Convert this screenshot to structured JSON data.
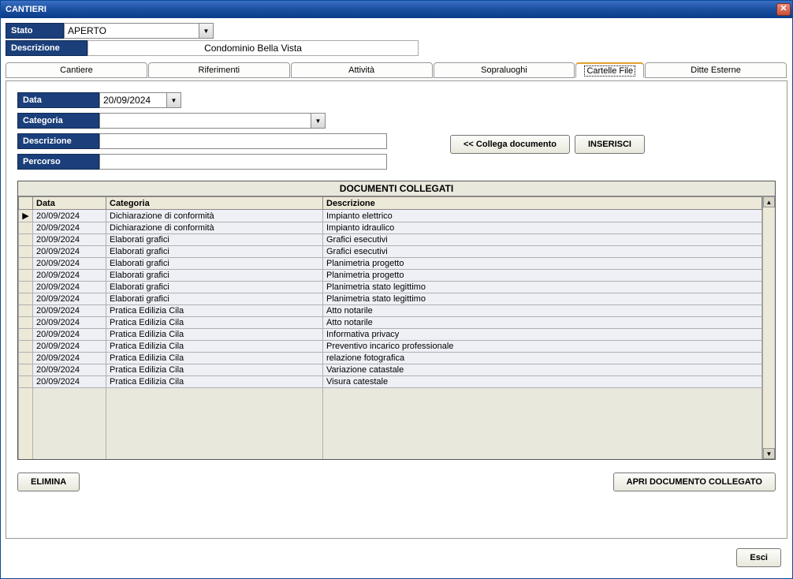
{
  "window": {
    "title": "CANTIERI"
  },
  "top": {
    "stato_label": "Stato",
    "stato_value": "APERTO",
    "descrizione_label": "Descrizione",
    "descrizione_value": "Condominio Bella Vista"
  },
  "tabs": [
    {
      "label": "Cantiere"
    },
    {
      "label": "Riferimenti"
    },
    {
      "label": "Attività"
    },
    {
      "label": "Sopraluoghi"
    },
    {
      "label": "Cartelle File",
      "active": true
    },
    {
      "label": "Ditte Esterne"
    }
  ],
  "filters": {
    "data_label": "Data",
    "data_value": "20/09/2024",
    "categoria_label": "Categoria",
    "categoria_value": "",
    "descrizione_label": "Descrizione",
    "descrizione_value": "",
    "percorso_label": "Percorso",
    "percorso_value": ""
  },
  "buttons": {
    "collega": "<< Collega documento",
    "inserisci": "INSERISCI",
    "elimina": "ELIMINA",
    "apri": "APRI DOCUMENTO COLLEGATO",
    "esci": "Esci"
  },
  "grid": {
    "title": "DOCUMENTI COLLEGATI",
    "headers": {
      "data": "Data",
      "categoria": "Categoria",
      "descrizione": "Descrizione"
    },
    "rows": [
      {
        "marker": "▶",
        "data": "20/09/2024",
        "categoria": "Dichiarazione di conformità",
        "descrizione": "Impianto elettrico"
      },
      {
        "marker": "",
        "data": "20/09/2024",
        "categoria": "Dichiarazione di conformità",
        "descrizione": "Impianto idraulico"
      },
      {
        "marker": "",
        "data": "20/09/2024",
        "categoria": "Elaborati grafici",
        "descrizione": "Grafici esecutivi"
      },
      {
        "marker": "",
        "data": "20/09/2024",
        "categoria": "Elaborati grafici",
        "descrizione": "Grafici esecutivi"
      },
      {
        "marker": "",
        "data": "20/09/2024",
        "categoria": "Elaborati grafici",
        "descrizione": "Planimetria progetto"
      },
      {
        "marker": "",
        "data": "20/09/2024",
        "categoria": "Elaborati grafici",
        "descrizione": "Planimetria progetto"
      },
      {
        "marker": "",
        "data": "20/09/2024",
        "categoria": "Elaborati grafici",
        "descrizione": "Planimetria stato legittimo"
      },
      {
        "marker": "",
        "data": "20/09/2024",
        "categoria": "Elaborati grafici",
        "descrizione": "Planimetria stato legittimo"
      },
      {
        "marker": "",
        "data": "20/09/2024",
        "categoria": "Pratica Edilizia Cila",
        "descrizione": "Atto notarile"
      },
      {
        "marker": "",
        "data": "20/09/2024",
        "categoria": "Pratica Edilizia Cila",
        "descrizione": "Atto notarile"
      },
      {
        "marker": "",
        "data": "20/09/2024",
        "categoria": "Pratica Edilizia Cila",
        "descrizione": "Informativa privacy"
      },
      {
        "marker": "",
        "data": "20/09/2024",
        "categoria": "Pratica Edilizia Cila",
        "descrizione": "Preventivo incarico professionale"
      },
      {
        "marker": "",
        "data": "20/09/2024",
        "categoria": "Pratica Edilizia Cila",
        "descrizione": "relazione fotografica"
      },
      {
        "marker": "",
        "data": "20/09/2024",
        "categoria": "Pratica Edilizia Cila",
        "descrizione": "Variazione catastale"
      },
      {
        "marker": "",
        "data": "20/09/2024",
        "categoria": "Pratica Edilizia Cila",
        "descrizione": "Visura catestale"
      }
    ]
  }
}
